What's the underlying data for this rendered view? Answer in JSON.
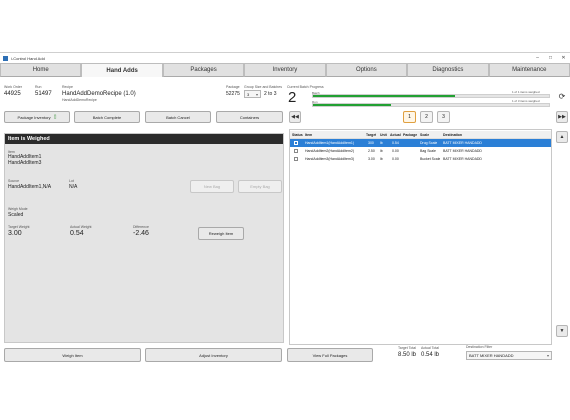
{
  "window": {
    "title": "i-Control Hand Add"
  },
  "tabs": [
    "Home",
    "Hand Adds",
    "Packages",
    "Inventory",
    "Options",
    "Diagnostics",
    "Maintenance"
  ],
  "header": {
    "work_order_label": "Work Order",
    "work_order": "44925",
    "run_label": "Run",
    "run": "51497",
    "recipe_label": "Recipe",
    "recipe": "HandAddDemoRecipe (1.0)",
    "recipe_sub": "HandAddDemoRecipe",
    "package_label": "Package",
    "package": "52275",
    "group_label": "Group Size and Batches",
    "group_size": "3",
    "group_of": "2 to 3",
    "current_batch_label": "Current Batch Progress",
    "current_batch": "2",
    "batch_label": "Batch",
    "batch_status": "1 of 1 items weighed",
    "batch_progress": 0.6,
    "run_bar_label": "Run",
    "run_status": "1 of 3 items weighed",
    "run_progress": 0.33,
    "refresh_icon": "refresh-icon"
  },
  "buttons": {
    "package_inventory": "Package Inventory",
    "batch_complete": "Batch Complete",
    "batch_cancel": "Batch Cancel",
    "containers": "Containers"
  },
  "panel": {
    "title": "Item is Weighed",
    "item_label": "Item",
    "item1": "HandAddItem1",
    "item2": "HandAddItem3",
    "source_label": "Source",
    "source": "HandAddItem1,N/A",
    "lot_label": "Lot",
    "lot": "N/A",
    "new_bag": "New Bag",
    "empty_bag": "Empty Bag",
    "weigh_mode_label": "Weigh Mode",
    "weigh_mode": "Scaled",
    "target_label": "Target Weight",
    "target": "3.00",
    "actual_label": "Actual Weight",
    "actual": "0.54",
    "difference_label": "Difference",
    "difference": "-2.46",
    "reweigh": "Reweigh Item"
  },
  "pager": {
    "pages": [
      "1",
      "2",
      "3"
    ],
    "current": "1"
  },
  "grid": {
    "columns": [
      "Status",
      "Item",
      "Target",
      "Unit",
      "Actual",
      "Package",
      "Scale",
      "Destination"
    ],
    "rows": [
      {
        "item": "HandAddItem1(HandAddItem1)",
        "target": "300",
        "unit": "lb",
        "actual": "0.54",
        "package": "",
        "scale": "Drug Scale",
        "destination": "BATT MIXER HANDADD",
        "selected": true
      },
      {
        "item": "HandAddItem2(HandAddItem2)",
        "target": "2.50",
        "unit": "lb",
        "actual": "0.00",
        "package": "",
        "scale": "Bag Scale",
        "destination": "BATT MIXER HANDADD",
        "selected": false
      },
      {
        "item": "HandAddItem3(HandAddItem3)",
        "target": "3.00",
        "unit": "lb",
        "actual": "0.00",
        "package": "",
        "scale": "Bucket Scale",
        "destination": "BATT MIXER HANDADD",
        "selected": false
      }
    ]
  },
  "footer": {
    "weigh_item": "Weigh Item",
    "adjust_inventory": "Adjust Inventory",
    "view_full_packages": "View Full Packages",
    "target_total_label": "Target Total",
    "target_total": "8.50 lb",
    "actual_total_label": "Actual Total",
    "actual_total": "0.54 lb",
    "destination_filter_label": "Destination Filter",
    "destination_filter": "BATT MIXER HANDADD"
  }
}
